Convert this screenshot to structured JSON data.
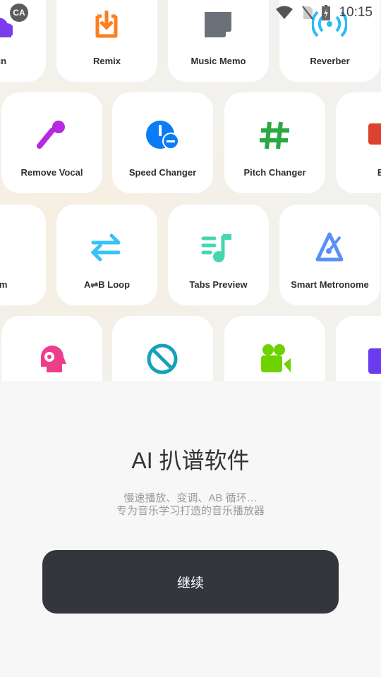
{
  "status_bar": {
    "time": "10:15",
    "icons": [
      "wifi-icon",
      "no-sim-icon",
      "battery-charging-icon"
    ]
  },
  "notification_icon": "CA",
  "tiles": [
    {
      "label": "Sycn",
      "icon": "cloud-sync-icon",
      "color": "#7b3cf0"
    },
    {
      "label": "Remix",
      "icon": "download-tray-icon",
      "color": "#ff7e1c"
    },
    {
      "label": "Music Memo",
      "icon": "note-icon",
      "color": "#6b7079"
    },
    {
      "label": "Reverber",
      "icon": "broadcast-icon",
      "color": "#2cbcf4"
    },
    {
      "label": "Remove Vocal",
      "icon": "microphone-icon",
      "color": "#b52ae0"
    },
    {
      "label": "Speed Changer",
      "icon": "speedometer-minus-icon",
      "color": "#0a7cf5"
    },
    {
      "label": "Pitch Changer",
      "icon": "hash-icon",
      "color": "#2aa844"
    },
    {
      "label": "Boo",
      "icon": "booster-icon",
      "color": "#dc4230"
    },
    {
      "label": "Drum",
      "icon": "drum-icon",
      "color": "#1296a8"
    },
    {
      "label": "A⇌B Loop",
      "icon": "swap-arrows-icon",
      "color": "#36c3f5"
    },
    {
      "label": "Tabs Preview",
      "icon": "music-list-icon",
      "color": "#45d6b0"
    },
    {
      "label": "Smart Metronome",
      "icon": "metronome-icon",
      "color": "#5b8ff7"
    },
    {
      "label": "",
      "icon": "head-headphones-icon",
      "color": "#ec3e8a"
    },
    {
      "label": "",
      "icon": "block-icon",
      "color": "#15a1b8"
    },
    {
      "label": "",
      "icon": "video-camera-icon",
      "color": "#6dd300"
    },
    {
      "label": "",
      "icon": "calendar-icon",
      "color": "#6a3cf0"
    }
  ],
  "sheet": {
    "title": "AI 扒谱软件",
    "subtitle_line1": "慢速播放、变调、AB 循环…",
    "subtitle_line2": "专为音乐学习打造的音乐播放器",
    "continue_label": "继续"
  }
}
